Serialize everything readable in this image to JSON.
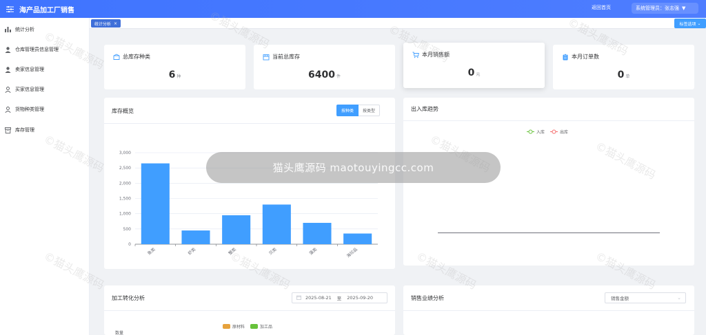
{
  "header": {
    "app_title": "海产品加工厂销售",
    "back_home": "返回首页",
    "user_label": "系统管理员：张志强"
  },
  "sidebar": {
    "items": [
      {
        "label": "统计分析",
        "icon": "bar-chart-icon"
      },
      {
        "label": "仓库管理员信息管理",
        "icon": "user-icon"
      },
      {
        "label": "卖家信息管理",
        "icon": "user-icon"
      },
      {
        "label": "买家信息管理",
        "icon": "user-outline-icon"
      },
      {
        "label": "货物种类管理",
        "icon": "user-outline-icon"
      },
      {
        "label": "库存管理",
        "icon": "box-icon"
      }
    ]
  },
  "tags": {
    "active_tag": "统计分析",
    "close_symbol": "×",
    "ops_label": "标签选项"
  },
  "stats": [
    {
      "title": "总库存种类",
      "value": "6",
      "unit": "种",
      "icon": "box-outline-icon"
    },
    {
      "title": "当前总库存",
      "value": "6400",
      "unit": "件",
      "icon": "calendar-box-icon"
    },
    {
      "title": "本月销售额",
      "value": "0",
      "unit": "元",
      "icon": "cart-icon"
    },
    {
      "title": "本月订单数",
      "value": "0",
      "unit": "单",
      "icon": "clipboard-icon"
    }
  ],
  "inventory_panel": {
    "title": "库存概览",
    "toggle": [
      "按种类",
      "按类型"
    ]
  },
  "trend_panel": {
    "title": "出入库趋势",
    "legend": [
      "入库",
      "出库"
    ]
  },
  "processing_panel": {
    "title": "加工转化分析",
    "date_start": "2025-08-21",
    "date_sep": "至",
    "date_end": "2025-09-20",
    "legend": [
      "原材料",
      "加工品"
    ],
    "ylabel": "数量"
  },
  "sales_panel": {
    "title": "销售业绩分析",
    "select_value": "销售金额"
  },
  "colors": {
    "primary": "#409eff",
    "header": "#3f74ff",
    "in_line": "#67c23a",
    "out_line": "#f56c6c",
    "raw": "#e6a23c",
    "processed": "#67c23a"
  },
  "overlay": {
    "watermark": "猫头鹰源码 maotouyingcc.com"
  },
  "chart_data": [
    {
      "type": "bar",
      "categories": [
        "鱼类",
        "虾类",
        "蟹类",
        "贝类",
        "藻类",
        "海珍品"
      ],
      "values": [
        2650,
        450,
        950,
        1300,
        700,
        350
      ],
      "ylim": [
        0,
        3000
      ],
      "yticks": [
        "0",
        "500",
        "1,000",
        "1,500",
        "2,000",
        "2,500",
        "3,000"
      ],
      "grid": true
    },
    {
      "type": "line",
      "series": [
        {
          "name": "入库",
          "values": []
        },
        {
          "name": "出库",
          "values": []
        }
      ]
    }
  ]
}
